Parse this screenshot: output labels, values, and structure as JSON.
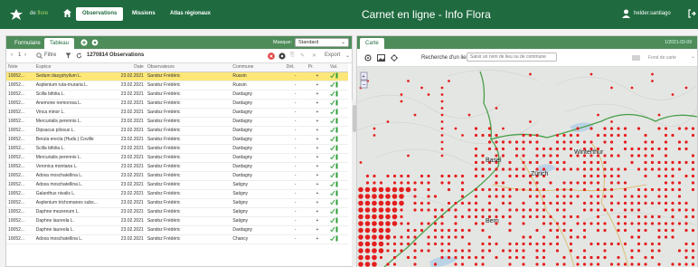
{
  "topbar": {
    "brand_prefix": "de",
    "brand_suffix": "flore",
    "nav": [
      "Observations",
      "Missions",
      "Atlas régionaux"
    ],
    "app_title": "Carnet en ligne - Info Flora",
    "user": "helder.santiago"
  },
  "left": {
    "tabs": [
      "Formulaire",
      "Tableau"
    ],
    "masque_label": "Masque:",
    "masque_value": "Standard",
    "pager": "1",
    "filter_label": "Filtre",
    "obs_count": "1270814 Observations",
    "export_label": "Export",
    "columns": [
      "Note",
      "Espèce",
      "Date",
      "Observateurs",
      "Commune",
      "Dét.",
      "Pr.",
      "Val."
    ],
    "rows": [
      [
        "10052...",
        "Sedum dasyphyllum L.",
        "23.02.2021",
        "Sandoz Frédéric",
        "Russin",
        "-",
        "+"
      ],
      [
        "10052...",
        "Asplenium ruta-muraria L.",
        "23.02.2021",
        "Sandoz Frédéric",
        "Russin",
        "-",
        "+"
      ],
      [
        "10052...",
        "Scilla bifolia L.",
        "23.02.2021",
        "Sandoz Frédéric",
        "Dardagny",
        "-",
        "+"
      ],
      [
        "10052...",
        "Anemone nemorosa L.",
        "23.02.2021",
        "Sandoz Frédéric",
        "Dardagny",
        "-",
        "+"
      ],
      [
        "10052...",
        "Vinca minor L.",
        "23.02.2021",
        "Sandoz Frédéric",
        "Dardagny",
        "-",
        "+"
      ],
      [
        "10052...",
        "Mercurialis perennis L.",
        "23.02.2021",
        "Sandoz Frédéric",
        "Dardagny",
        "-",
        "+"
      ],
      [
        "10052...",
        "Dipsacus pilosus L.",
        "23.02.2021",
        "Sandoz Frédéric",
        "Dardagny",
        "-",
        "+"
      ],
      [
        "10052...",
        "Berula erecta (Huds.) Coville",
        "23.02.2021",
        "Sandoz Frédéric",
        "Dardagny",
        "-",
        "+"
      ],
      [
        "10052...",
        "Scilla bifolia L.",
        "23.02.2021",
        "Sandoz Frédéric",
        "Dardagny",
        "-",
        "+"
      ],
      [
        "10052...",
        "Mercurialis perennis L.",
        "23.02.2021",
        "Sandoz Frédéric",
        "Dardagny",
        "-",
        "+"
      ],
      [
        "10052...",
        "Veronica montana L.",
        "23.02.2021",
        "Sandoz Frédéric",
        "Dardagny",
        "-",
        "+"
      ],
      [
        "10052...",
        "Adoxa moschatellina L.",
        "23.02.2021",
        "Sandoz Frédéric",
        "Dardagny",
        "-",
        "+"
      ],
      [
        "10052...",
        "Adoxa moschatellina L.",
        "23.02.2021",
        "Sandoz Frédéric",
        "Satigny",
        "-",
        "+"
      ],
      [
        "10052...",
        "Galanthus nivalis L.",
        "23.02.2021",
        "Sandoz Frédéric",
        "Satigny",
        "-",
        "+"
      ],
      [
        "10052...",
        "Asplenium trichomanes subs...",
        "23.02.2021",
        "Sandoz Frédéric",
        "Satigny",
        "-",
        "+"
      ],
      [
        "10052...",
        "Daphne mezereum L.",
        "23.02.2021",
        "Sandoz Frédéric",
        "Satigny",
        "-",
        "+"
      ],
      [
        "10052...",
        "Daphne laureola L.",
        "23.02.2021",
        "Sandoz Frédéric",
        "Satigny",
        "-",
        "+"
      ],
      [
        "10052...",
        "Daphne laureola L.",
        "23.02.2021",
        "Sandoz Frédéric",
        "Dardagny",
        "-",
        "+"
      ],
      [
        "10052...",
        "Adoxa moschatellina L.",
        "23.02.2021",
        "Sandoz Frédéric",
        "Chancy",
        "-",
        "+"
      ]
    ]
  },
  "right": {
    "tab": "Carte",
    "date": "1/2021-02-09",
    "search_label": "Recherche d'un lieu:",
    "search_placeholder": "Saisir un nom de lieu ou de commune",
    "fond_label": "Fond de carte",
    "map_labels": [
      "Basel",
      "Zürich",
      "Winterthur",
      "Bern"
    ]
  }
}
